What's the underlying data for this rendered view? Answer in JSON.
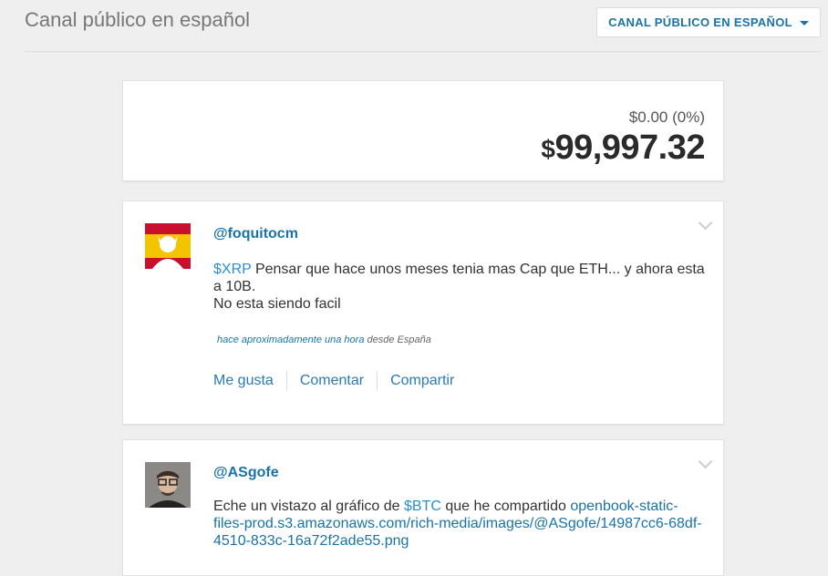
{
  "header": {
    "title": "Canal público en español",
    "channel_select": "CANAL PÚBLICO EN ESPAÑOL"
  },
  "balance": {
    "change": "$0.00 (0%)",
    "currency": "$",
    "total": "99,997.32"
  },
  "posts": [
    {
      "username": "@foquitocm",
      "cashtag": "$XRP",
      "text_after_cashtag": " Pensar que hace unos meses tenia mas Cap que ETH... y ahora esta a 10B.",
      "text_line2": "No esta siendo facil",
      "time": "hace aproximadamente una hora",
      "location": " desde España",
      "actions": {
        "like": "Me gusta",
        "comment": "Comentar",
        "share": "Compartir"
      }
    },
    {
      "username": "@ASgofe",
      "text_before": "Eche un vistazo al gráfico de ",
      "cashtag": "$BTC",
      "text_middle": " que he compartido ",
      "link": "openbook-static-files-prod.s3.amazonaws.com/rich-media/images/@ASgofe/14987cc6-68df-4510-833c-16a72f2ade55.png"
    }
  ],
  "colors": {
    "link": "#1a73a8",
    "cashtag": "#2a8fd0",
    "background": "#efefef"
  },
  "icons": {
    "select_caret": "caret-down-icon",
    "post_menu": "chevron-down-icon"
  }
}
